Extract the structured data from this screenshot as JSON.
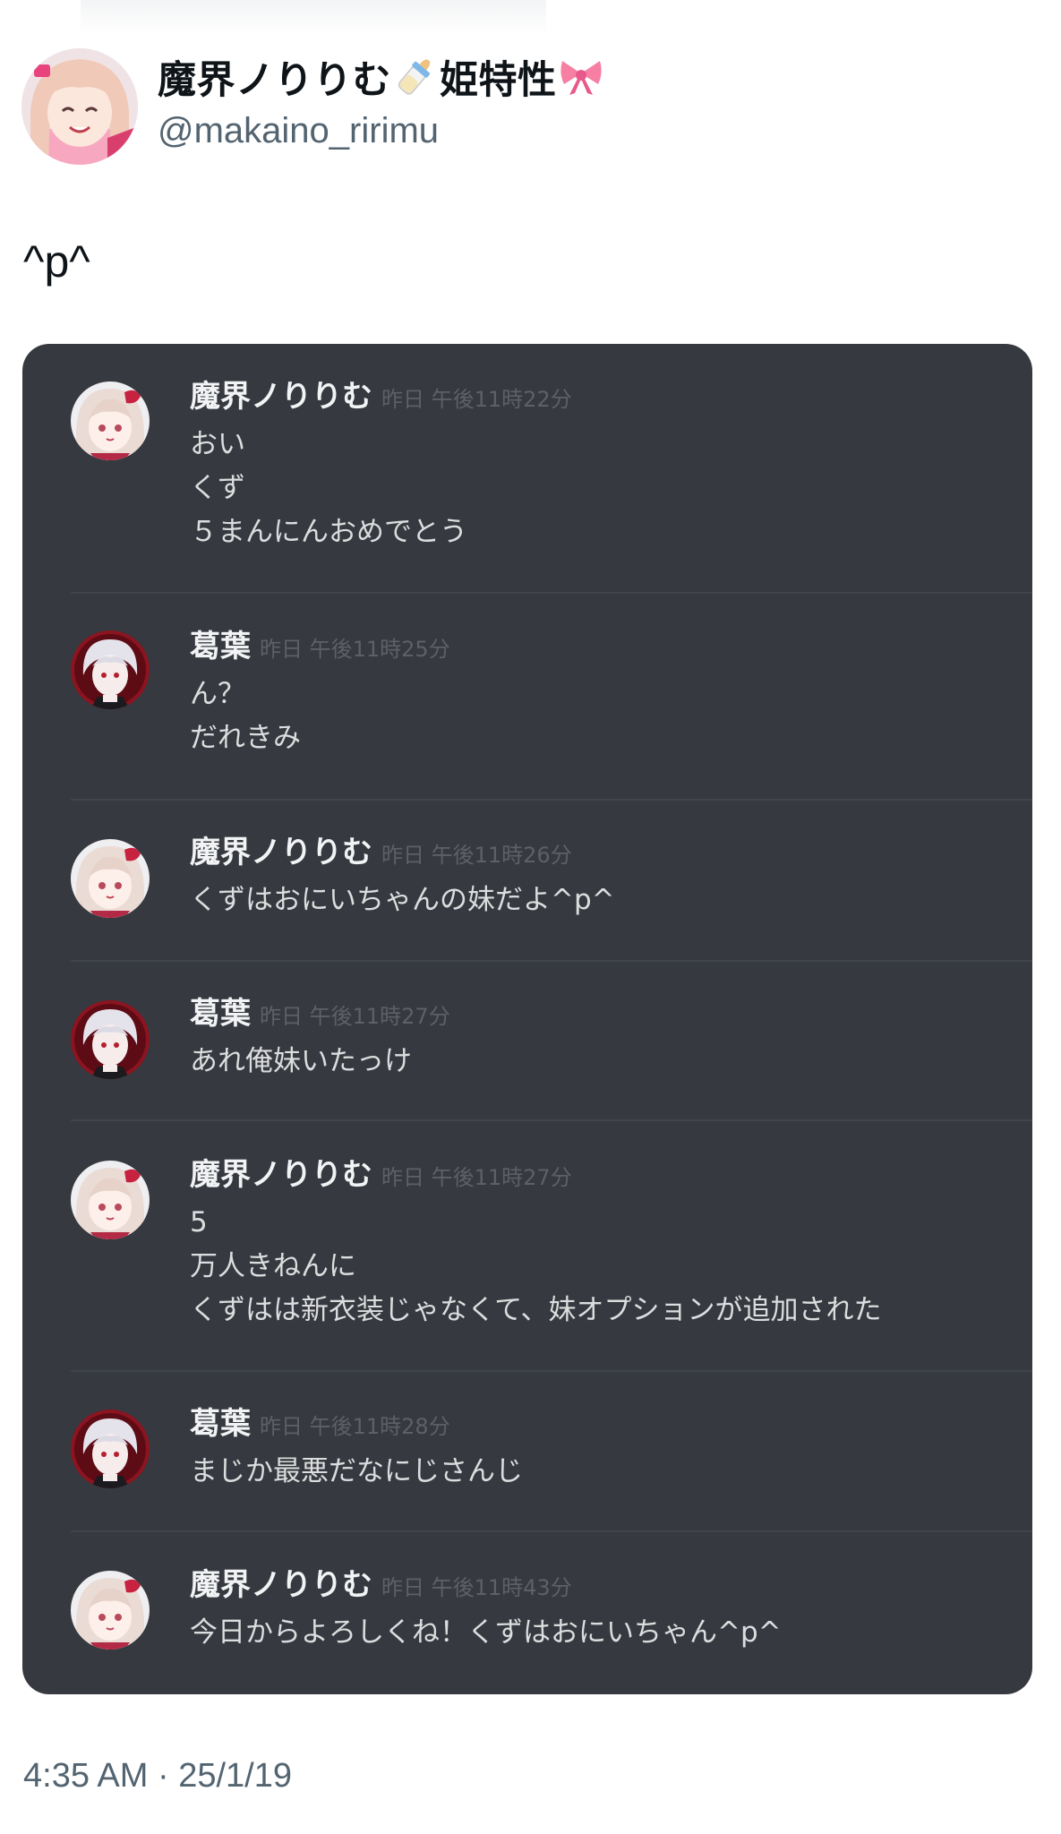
{
  "tweet": {
    "display_name": "魔界ノりりむ",
    "name_suffix": "姫特性",
    "name_emojis": [
      "baby-bottle-emoji",
      "ribbon-emoji"
    ],
    "handle": "@makaino_ririmu",
    "text": "^p^",
    "timestamp": "4:35 AM · 25/1/19"
  },
  "chat": {
    "messages": [
      {
        "author": "魔界ノりりむ",
        "time": "昨日 午後11時22分",
        "avatar": "ririmu-avatar",
        "lines": [
          "おい",
          "くず",
          "５まんにんおめでとう"
        ]
      },
      {
        "author": "葛葉",
        "time": "昨日 午後11時25分",
        "avatar": "kuzuha-avatar",
        "lines": [
          "ん？",
          "だれきみ"
        ]
      },
      {
        "author": "魔界ノりりむ",
        "time": "昨日 午後11時26分",
        "avatar": "ririmu-avatar",
        "lines": [
          "くずはおにいちゃんの妹だよ^p^"
        ]
      },
      {
        "author": "葛葉",
        "time": "昨日 午後11時27分",
        "avatar": "kuzuha-avatar",
        "lines": [
          "あれ俺妹いたっけ"
        ]
      },
      {
        "author": "魔界ノりりむ",
        "time": "昨日 午後11時27分",
        "avatar": "ririmu-avatar",
        "lines": [
          "5",
          "万人きねんに",
          "くずはは新衣装じゃなくて、妹オプションが追加された"
        ]
      },
      {
        "author": "葛葉",
        "time": "昨日 午後11時28分",
        "avatar": "kuzuha-avatar",
        "lines": [
          "まじか最悪だなにじさんじ"
        ]
      },
      {
        "author": "魔界ノりりむ",
        "time": "昨日 午後11時43分",
        "avatar": "ririmu-avatar",
        "lines": [
          "今日からよろしくね！くずはおにいちゃん^p^"
        ]
      }
    ]
  }
}
